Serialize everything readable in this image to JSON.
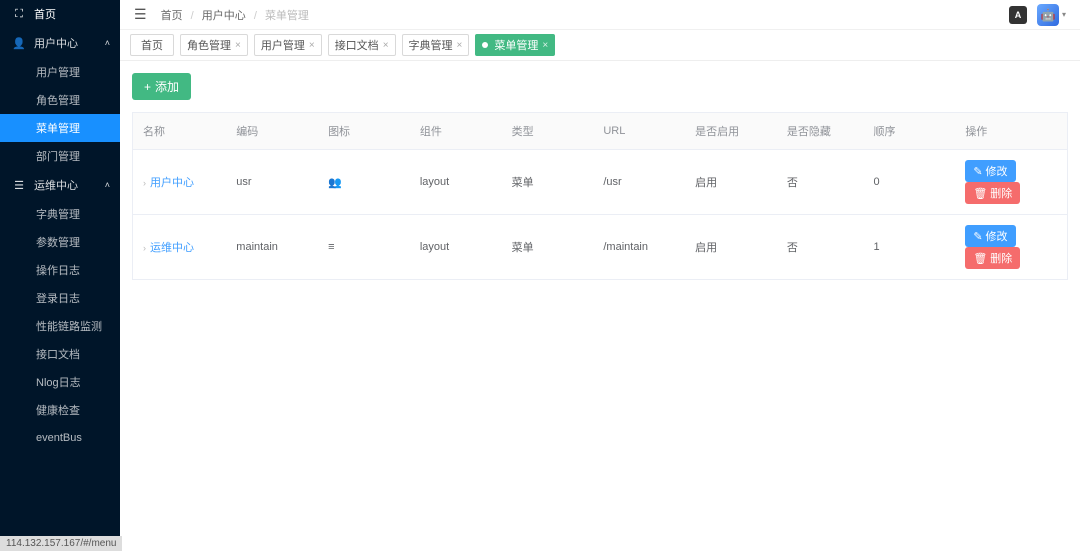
{
  "sidebar": {
    "home": "首页",
    "groups": [
      {
        "label": "用户中心",
        "items": [
          {
            "label": "用户管理",
            "active": false
          },
          {
            "label": "角色管理",
            "active": false
          },
          {
            "label": "菜单管理",
            "active": true
          },
          {
            "label": "部门管理",
            "active": false
          }
        ]
      },
      {
        "label": "运维中心",
        "items": [
          {
            "label": "字典管理"
          },
          {
            "label": "参数管理"
          },
          {
            "label": "操作日志"
          },
          {
            "label": "登录日志"
          },
          {
            "label": "性能链路监测"
          },
          {
            "label": "接口文档"
          },
          {
            "label": "Nlog日志"
          },
          {
            "label": "健康检查"
          },
          {
            "label": "eventBus"
          }
        ]
      }
    ]
  },
  "breadcrumb": {
    "items": [
      "首页",
      "用户中心",
      "菜单管理"
    ]
  },
  "lang_badge": "A",
  "tabs": [
    {
      "label": "首页",
      "closable": false,
      "active": false
    },
    {
      "label": "角色管理",
      "closable": true,
      "active": false
    },
    {
      "label": "用户管理",
      "closable": true,
      "active": false
    },
    {
      "label": "接口文档",
      "closable": true,
      "active": false
    },
    {
      "label": "字典管理",
      "closable": true,
      "active": false
    },
    {
      "label": "菜单管理",
      "closable": true,
      "active": true
    }
  ],
  "add_button": "添加",
  "table": {
    "headers": [
      "名称",
      "编码",
      "图标",
      "组件",
      "类型",
      "URL",
      "是否启用",
      "是否隐藏",
      "顺序",
      "操作"
    ],
    "edit_label": "修改",
    "delete_label": "删除",
    "rows": [
      {
        "name": "用户中心",
        "code": "usr",
        "icon": "👥",
        "component": "layout",
        "type": "菜单",
        "url": "/usr",
        "enabled": "启用",
        "hidden": "否",
        "order": "0"
      },
      {
        "name": "运维中心",
        "code": "maintain",
        "icon": "≡",
        "component": "layout",
        "type": "菜单",
        "url": "/maintain",
        "enabled": "启用",
        "hidden": "否",
        "order": "1"
      }
    ]
  },
  "status_url": "114.132.157.167/#/menu"
}
